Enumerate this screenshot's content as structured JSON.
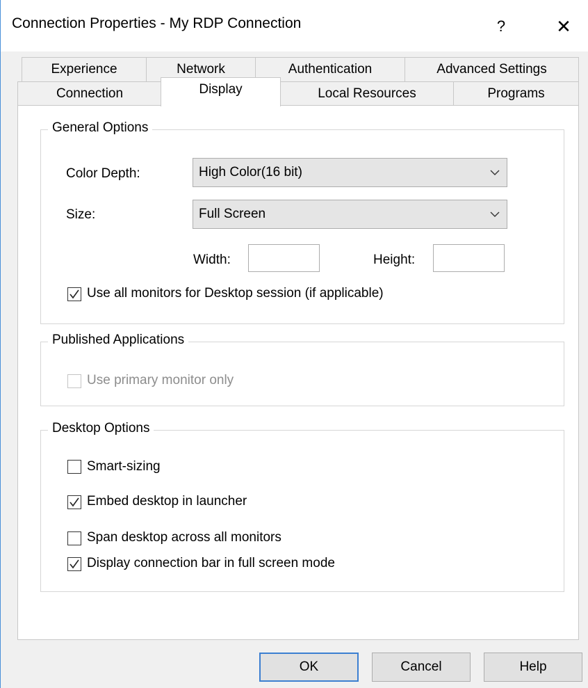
{
  "window": {
    "title": "Connection Properties - My RDP Connection",
    "help_glyph": "?",
    "close_glyph": "✕"
  },
  "tabs": {
    "row_top": [
      "Experience",
      "Network",
      "Authentication",
      "Advanced Settings"
    ],
    "row_bottom": [
      "Connection",
      "Display",
      "Local Resources",
      "Programs"
    ],
    "active": "Display"
  },
  "general_options": {
    "title": "General Options",
    "color_depth_label": "Color Depth:",
    "color_depth_value": "High Color(16 bit)",
    "size_label": "Size:",
    "size_value": "Full Screen",
    "width_label": "Width:",
    "width_value": "",
    "height_label": "Height:",
    "height_value": "",
    "use_all_monitors": {
      "label": "Use all monitors for Desktop session (if applicable)",
      "checked": true
    }
  },
  "published_applications": {
    "title": "Published Applications",
    "use_primary_monitor": {
      "label": "Use primary monitor only",
      "checked": false,
      "disabled": true
    }
  },
  "desktop_options": {
    "title": "Desktop Options",
    "smart_sizing": {
      "label": "Smart-sizing",
      "checked": false
    },
    "embed_desktop": {
      "label": "Embed desktop in launcher",
      "checked": true
    },
    "span_desktop": {
      "label": "Span desktop across all monitors",
      "checked": false
    },
    "connection_bar": {
      "label": "Display connection bar in full screen mode",
      "checked": true
    }
  },
  "buttons": {
    "ok": "OK",
    "cancel": "Cancel",
    "help": "Help"
  },
  "colors": {
    "default_button_border": "#3c7fd1",
    "dropdown_bg": "#e5e5e5",
    "window_bg": "#f0f0f0"
  }
}
